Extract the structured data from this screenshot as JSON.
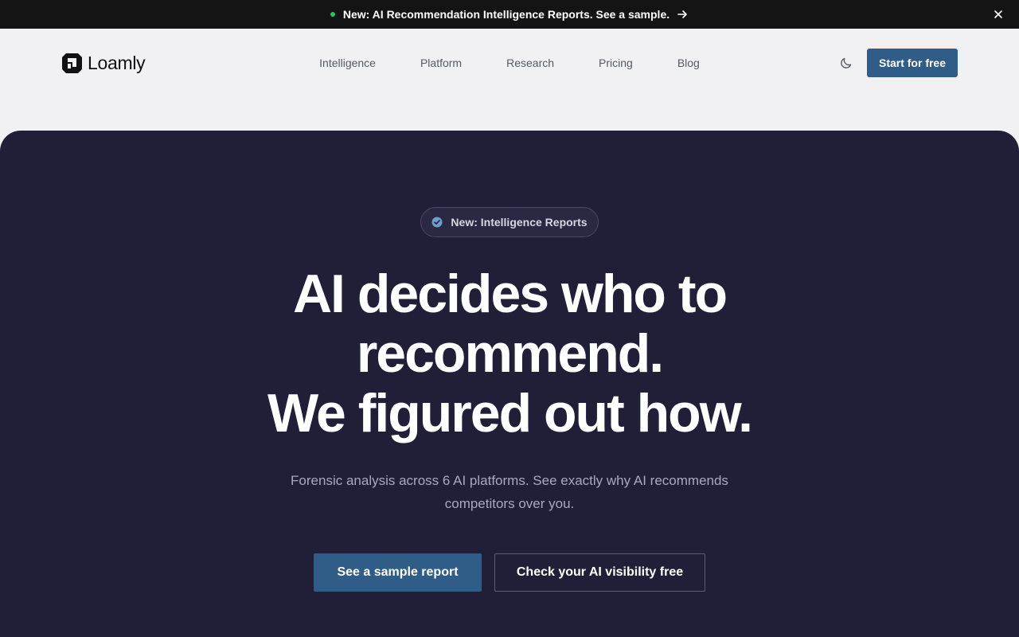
{
  "announcement": {
    "text": "New: AI Recommendation Intelligence Reports. See a sample.",
    "dot_color": "#22c55e"
  },
  "header": {
    "logo_text": "Loamly",
    "nav": [
      "Intelligence",
      "Platform",
      "Research",
      "Pricing",
      "Blog"
    ],
    "cta_label": "Start for free"
  },
  "hero": {
    "badge_text": "New: Intelligence Reports",
    "headline_lines": [
      "AI decides who to",
      "recommend.",
      "We figured out how."
    ],
    "subtext": "Forensic analysis across 6 AI platforms. See exactly why AI recommends competitors over you.",
    "primary_button": "See a sample report",
    "secondary_button": "Check your AI visibility free"
  },
  "colors": {
    "accent": "#2f5d88",
    "hero_bg": "#211f38",
    "page_bg": "#f1f1f3",
    "announce_bg": "#141414"
  },
  "icons": {
    "announcement_arrow": "arrow-right-icon",
    "announcement_close": "close-icon",
    "theme_toggle": "moon-icon",
    "badge": "check-circle-icon"
  }
}
